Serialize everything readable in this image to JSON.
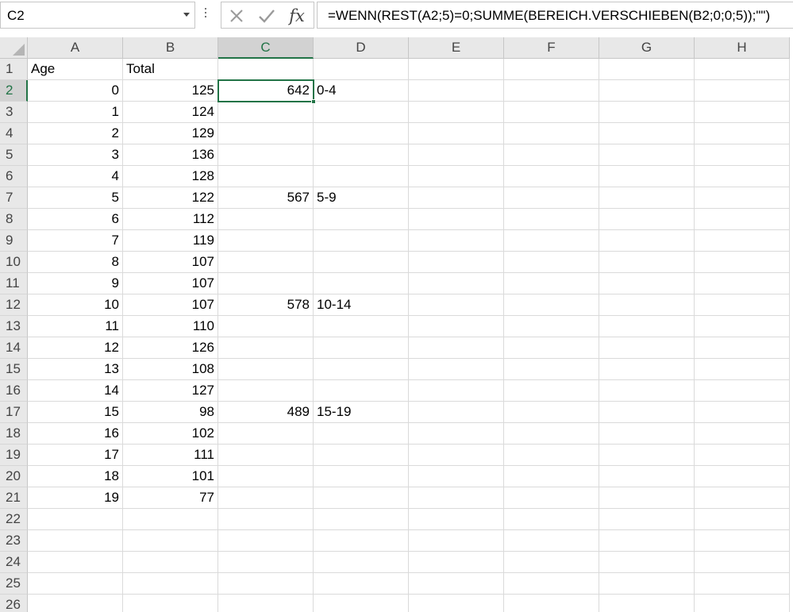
{
  "name_box": {
    "value": "C2"
  },
  "formula_bar": {
    "formula": "=WENN(REST(A2;5)=0;SUMME(BEREICH.VERSCHIEBEN(B2;0;0;5));\"\")",
    "icons": {
      "cancel": "close-icon",
      "enter": "check-icon",
      "function": "fx-icon"
    },
    "fx_label": "fx"
  },
  "selection": {
    "cell": "C2",
    "column": "C",
    "row": "2"
  },
  "columns": [
    "A",
    "B",
    "C",
    "D",
    "E",
    "F",
    "G",
    "H"
  ],
  "rows": [
    {
      "n": "1",
      "A": "Age",
      "B": "Total",
      "C": "",
      "D": ""
    },
    {
      "n": "2",
      "A": "0",
      "B": "125",
      "C": "642",
      "D": "0-4"
    },
    {
      "n": "3",
      "A": "1",
      "B": "124",
      "C": "",
      "D": ""
    },
    {
      "n": "4",
      "A": "2",
      "B": "129",
      "C": "",
      "D": ""
    },
    {
      "n": "5",
      "A": "3",
      "B": "136",
      "C": "",
      "D": ""
    },
    {
      "n": "6",
      "A": "4",
      "B": "128",
      "C": "",
      "D": ""
    },
    {
      "n": "7",
      "A": "5",
      "B": "122",
      "C": "567",
      "D": "5-9"
    },
    {
      "n": "8",
      "A": "6",
      "B": "112",
      "C": "",
      "D": ""
    },
    {
      "n": "9",
      "A": "7",
      "B": "119",
      "C": "",
      "D": ""
    },
    {
      "n": "10",
      "A": "8",
      "B": "107",
      "C": "",
      "D": ""
    },
    {
      "n": "11",
      "A": "9",
      "B": "107",
      "C": "",
      "D": ""
    },
    {
      "n": "12",
      "A": "10",
      "B": "107",
      "C": "578",
      "D": "10-14"
    },
    {
      "n": "13",
      "A": "11",
      "B": "110",
      "C": "",
      "D": ""
    },
    {
      "n": "14",
      "A": "12",
      "B": "126",
      "C": "",
      "D": ""
    },
    {
      "n": "15",
      "A": "13",
      "B": "108",
      "C": "",
      "D": ""
    },
    {
      "n": "16",
      "A": "14",
      "B": "127",
      "C": "",
      "D": ""
    },
    {
      "n": "17",
      "A": "15",
      "B": "98",
      "C": "489",
      "D": "15-19"
    },
    {
      "n": "18",
      "A": "16",
      "B": "102",
      "C": "",
      "D": ""
    },
    {
      "n": "19",
      "A": "17",
      "B": "111",
      "C": "",
      "D": ""
    },
    {
      "n": "20",
      "A": "18",
      "B": "101",
      "C": "",
      "D": ""
    },
    {
      "n": "21",
      "A": "19",
      "B": "77",
      "C": "",
      "D": ""
    },
    {
      "n": "22",
      "A": "",
      "B": "",
      "C": "",
      "D": ""
    },
    {
      "n": "23",
      "A": "",
      "B": "",
      "C": "",
      "D": ""
    },
    {
      "n": "24",
      "A": "",
      "B": "",
      "C": "",
      "D": ""
    },
    {
      "n": "25",
      "A": "",
      "B": "",
      "C": "",
      "D": ""
    },
    {
      "n": "26",
      "A": "",
      "B": "",
      "C": "",
      "D": ""
    }
  ],
  "colors": {
    "accent": "#217346",
    "header_bg": "#e8e8e8",
    "selected_header_bg": "#d2d2d2",
    "gridline": "#dadada"
  }
}
